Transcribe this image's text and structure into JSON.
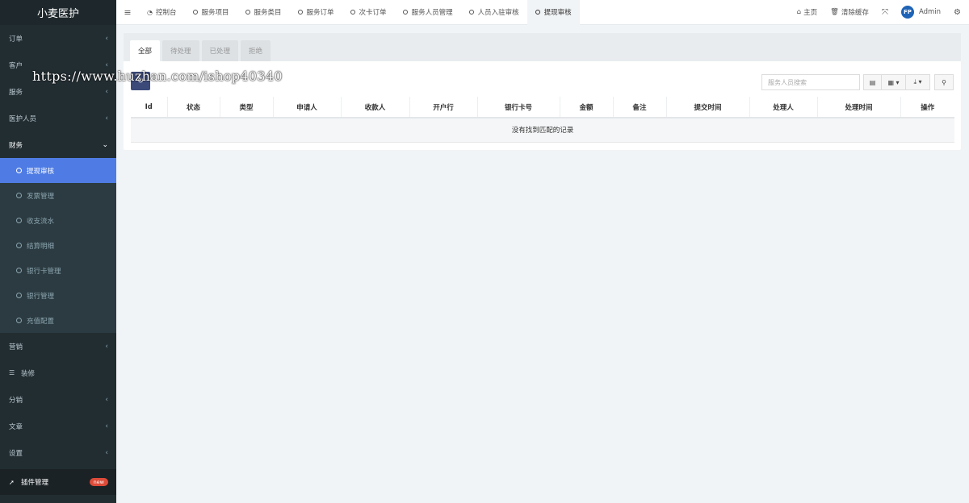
{
  "sidebar": {
    "brand": "小麦医护",
    "items": [
      {
        "label": "订单"
      },
      {
        "label": "客户"
      },
      {
        "label": "服务"
      },
      {
        "label": "医护人员"
      },
      {
        "label": "财务"
      }
    ],
    "finance_sub": [
      {
        "label": "提现审核"
      },
      {
        "label": "发票管理"
      },
      {
        "label": "收支流水"
      },
      {
        "label": "结算明细"
      },
      {
        "label": "银行卡管理"
      },
      {
        "label": "银行管理"
      },
      {
        "label": "充值配置"
      }
    ],
    "items2": [
      {
        "label": "营销"
      },
      {
        "label": "装修"
      },
      {
        "label": "分销"
      },
      {
        "label": "文章"
      },
      {
        "label": "设置"
      }
    ],
    "plugin_label": "插件管理",
    "plugin_badge": "new"
  },
  "topbar": {
    "tabs": [
      {
        "label": "控制台"
      },
      {
        "label": "服务项目"
      },
      {
        "label": "服务类目"
      },
      {
        "label": "服务订单"
      },
      {
        "label": "次卡订单"
      },
      {
        "label": "服务人员管理"
      },
      {
        "label": "人员入驻审核"
      },
      {
        "label": "提现审核"
      }
    ],
    "home": "主页",
    "clear_cache": "清除缓存",
    "user": "Admin",
    "avatar_text": "FP"
  },
  "panel": {
    "tabs": [
      {
        "label": "全部"
      },
      {
        "label": "待处理"
      },
      {
        "label": "已处理"
      },
      {
        "label": "拒绝"
      }
    ],
    "search_placeholder": "服务人员搜索",
    "columns": [
      "Id",
      "状态",
      "类型",
      "申请人",
      "收款人",
      "开户行",
      "银行卡号",
      "金额",
      "备注",
      "提交时间",
      "处理人",
      "处理时间",
      "操作"
    ],
    "empty_text": "没有找到匹配的记录"
  },
  "watermark": "https://www.huzhan.com/ishop40340",
  "colors": {
    "sidebar_bg": "#222d32",
    "active_blue": "#4f7ce4",
    "refresh_btn": "#3c4a7a",
    "badge_red": "#dd4b39"
  }
}
